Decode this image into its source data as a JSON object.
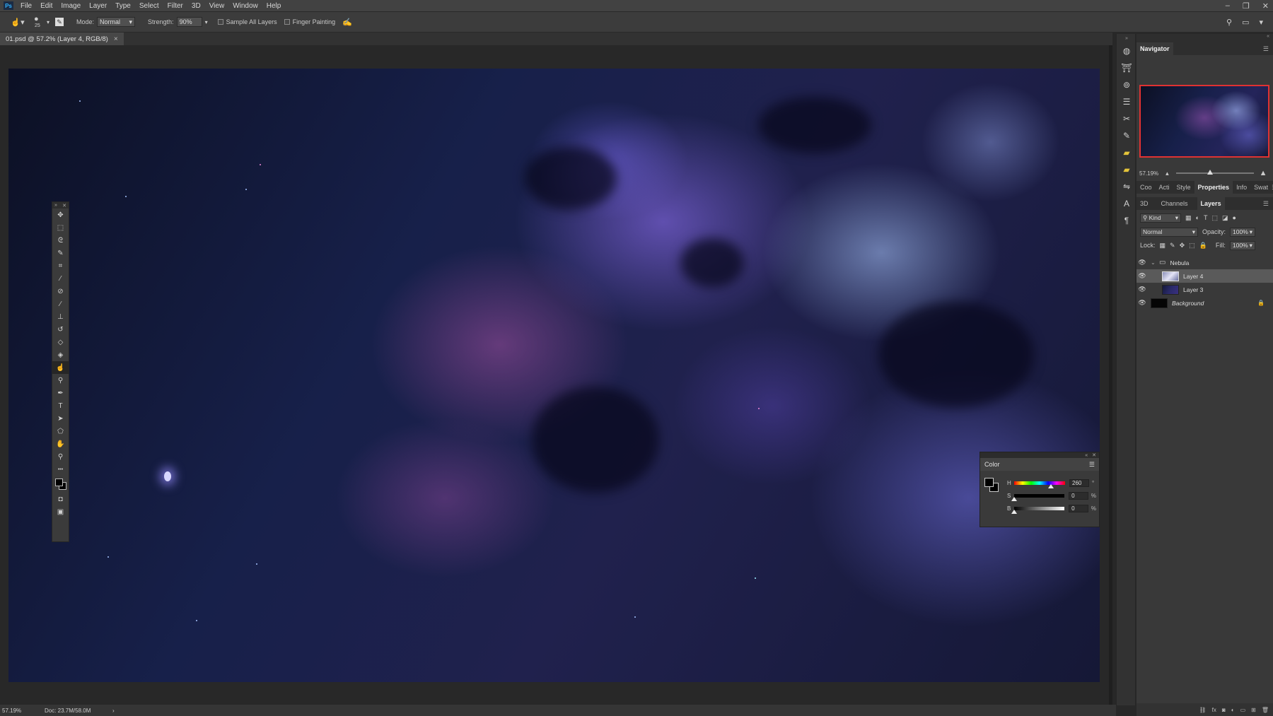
{
  "app": {
    "logo": "Ps"
  },
  "menu": [
    "File",
    "Edit",
    "Image",
    "Layer",
    "Type",
    "Select",
    "Filter",
    "3D",
    "View",
    "Window",
    "Help"
  ],
  "window_controls": {
    "minimize": "–",
    "restore": "❐",
    "close": "✕"
  },
  "options": {
    "brush_size": "25",
    "mode_label": "Mode:",
    "mode_value": "Normal",
    "strength_label": "Strength:",
    "strength_value": "90%",
    "sample_all_layers": "Sample All Layers",
    "finger_painting": "Finger Painting"
  },
  "document_tab": {
    "title": "01.psd @ 57.2% (Layer 4, RGB/8)",
    "close": "×"
  },
  "tools": [
    {
      "name": "move-tool-icon",
      "glyph": "✥"
    },
    {
      "name": "marquee-tool-icon",
      "glyph": "⬚"
    },
    {
      "name": "lasso-tool-icon",
      "glyph": "ᘓ"
    },
    {
      "name": "quick-select-tool-icon",
      "glyph": "✎"
    },
    {
      "name": "crop-tool-icon",
      "glyph": "⌗"
    },
    {
      "name": "eyedropper-tool-icon",
      "glyph": "⁄"
    },
    {
      "name": "healing-brush-tool-icon",
      "glyph": "⊘"
    },
    {
      "name": "brush-tool-icon",
      "glyph": "∕"
    },
    {
      "name": "stamp-tool-icon",
      "glyph": "⊥"
    },
    {
      "name": "history-brush-tool-icon",
      "glyph": "↺"
    },
    {
      "name": "eraser-tool-icon",
      "glyph": "◇"
    },
    {
      "name": "paint-bucket-tool-icon",
      "glyph": "◈"
    },
    {
      "name": "smudge-tool-icon",
      "glyph": "☝"
    },
    {
      "name": "dodge-tool-icon",
      "glyph": "⚲"
    },
    {
      "name": "pen-tool-icon",
      "glyph": "✒"
    },
    {
      "name": "type-tool-icon",
      "glyph": "T"
    },
    {
      "name": "path-select-tool-icon",
      "glyph": "➤"
    },
    {
      "name": "shape-tool-icon",
      "glyph": "⬠"
    },
    {
      "name": "hand-tool-icon",
      "glyph": "✋"
    },
    {
      "name": "zoom-tool-icon",
      "glyph": "⚲"
    },
    {
      "name": "more-tools-icon",
      "glyph": "•••"
    }
  ],
  "color_panel": {
    "title": "Color",
    "h_label": "H",
    "h_value": "260",
    "h_unit": "°",
    "s_label": "S",
    "s_value": "0",
    "s_unit": "%",
    "b_label": "B",
    "b_value": "0",
    "b_unit": "%",
    "hue_position": 0.72
  },
  "navigator": {
    "title": "Navigator",
    "zoom": "57.19%"
  },
  "panel_tabs_row1": [
    "Coo",
    "Acti",
    "Style",
    "Properties",
    "Info",
    "Swat"
  ],
  "panel_tabs_row2": [
    "3D",
    "Channels",
    "Layers"
  ],
  "layers_panel": {
    "kind_label": "Kind",
    "blend_mode": "Normal",
    "opacity_label": "Opacity:",
    "opacity_value": "100%",
    "lock_label": "Lock:",
    "fill_label": "Fill:",
    "fill_value": "100%",
    "layers": [
      {
        "name": "Nebula",
        "type": "group"
      },
      {
        "name": "Layer 4",
        "type": "layer",
        "selected": true
      },
      {
        "name": "Layer 3",
        "type": "layer"
      },
      {
        "name": "Background",
        "type": "background",
        "locked": true
      }
    ],
    "footer_icons": [
      "link-icon",
      "fx-icon",
      "mask-icon",
      "adjustment-icon",
      "folder-icon",
      "new-layer-icon",
      "trash-icon"
    ]
  },
  "status": {
    "zoom": "57.19%",
    "doc": "Doc: 23.7M/58.0M",
    "arrow": "›"
  },
  "colors": {
    "accent_red": "#e03232",
    "selected_layer": "#5a5a5a",
    "icon_yellow": "#e4c43a"
  }
}
